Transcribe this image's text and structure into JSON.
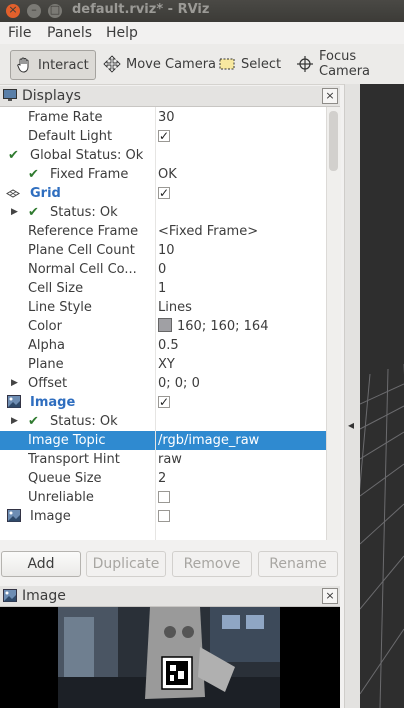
{
  "window": {
    "title": "default.rviz* - RViz",
    "close_glyph": "×",
    "min_glyph": "–",
    "max_glyph": "□"
  },
  "menu": {
    "file": "File",
    "panels": "Panels",
    "help": "Help"
  },
  "toolbar": {
    "interact": "Interact",
    "move_camera": "Move Camera",
    "select": "Select",
    "focus_camera": "Focus Camera"
  },
  "displays_panel": {
    "title": "Displays",
    "close": "×",
    "rows": [
      {
        "key": "Frame Rate",
        "value": "30"
      },
      {
        "key": "Default Light",
        "checked": true
      },
      {
        "key": "Global Status: Ok"
      },
      {
        "key": "Fixed Frame",
        "value": "OK"
      },
      {
        "key": "Grid",
        "checked": true
      },
      {
        "key": "Status: Ok"
      },
      {
        "key": "Reference Frame",
        "value": "<Fixed Frame>"
      },
      {
        "key": "Plane Cell Count",
        "value": "10"
      },
      {
        "key": "Normal Cell Co...",
        "value": "0"
      },
      {
        "key": "Cell Size",
        "value": "1"
      },
      {
        "key": "Line Style",
        "value": "Lines"
      },
      {
        "key": "Color",
        "value": "160; 160; 164"
      },
      {
        "key": "Alpha",
        "value": "0.5"
      },
      {
        "key": "Plane",
        "value": "XY"
      },
      {
        "key": "Offset",
        "value": "0; 0; 0"
      },
      {
        "key": "Image",
        "checked": true
      },
      {
        "key": "Status: Ok"
      },
      {
        "key": "Image Topic",
        "value": "/rgb/image_raw",
        "selected": true
      },
      {
        "key": "Transport Hint",
        "value": "raw"
      },
      {
        "key": "Queue Size",
        "value": "2"
      },
      {
        "key": "Unreliable",
        "checked": false
      },
      {
        "key": "Image",
        "checked": false
      }
    ]
  },
  "buttons": {
    "add": "Add",
    "duplicate": "Duplicate",
    "remove": "Remove",
    "rename": "Rename"
  },
  "image_panel": {
    "title": "Image",
    "close": "×"
  },
  "splitter": {
    "arrow": "◂"
  },
  "colors": {
    "selection": "#2f8ad0",
    "ok": "#2f7a2f",
    "grid_color": "#a0a0a4"
  },
  "glyphs": {
    "check": "✓",
    "tick": "✔",
    "expand": "▶"
  }
}
